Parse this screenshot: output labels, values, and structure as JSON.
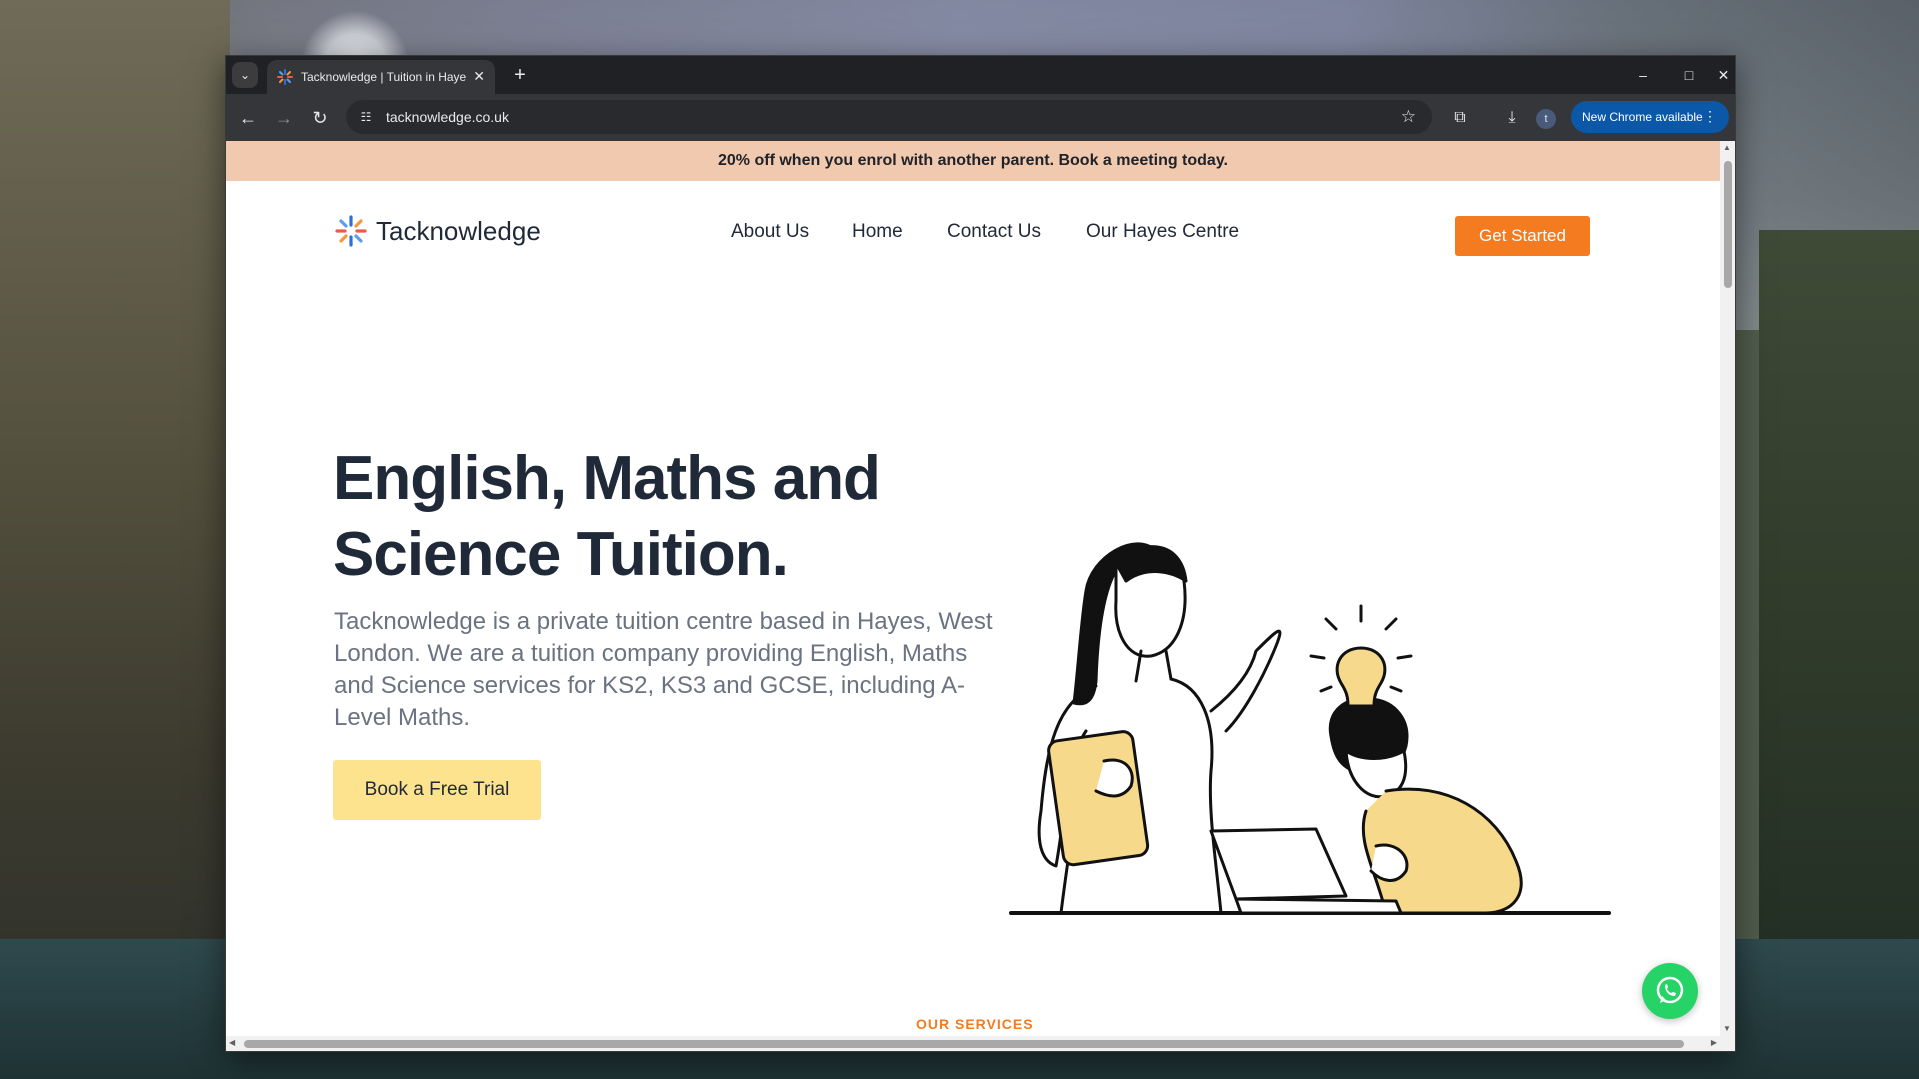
{
  "browser": {
    "tab_title": "Tacknowledge | Tuition in Hayes",
    "tab_close": "✕",
    "new_tab": "+",
    "url": "tacknowledge.co.uk",
    "update_label": "New Chrome available",
    "profile_initial": "t"
  },
  "site": {
    "promo": "20% off when you enrol with another parent. Book a meeting today.",
    "brand_name": "Tacknowledge",
    "nav": [
      "About Us",
      "Home",
      "Contact Us",
      "Our Hayes Centre"
    ],
    "cta": "Get Started",
    "hero_title_line1": "English, Maths and",
    "hero_title_line2": "Science Tuition.",
    "hero_text": "Tacknowledge is a private tuition centre based in Hayes, West London. We are a tuition company providing English, Maths and Science services for KS2, KS3 and GCSE, including A-Level Maths.",
    "trial_button": "Book a Free Trial",
    "services_label": "OUR SERVICES"
  },
  "colors": {
    "promo_bg": "#f1c9ae",
    "accent_orange": "#f47b20",
    "trial_yellow": "#fde38e",
    "heading": "#1f2937",
    "body_text": "#6b7280",
    "whatsapp_green": "#25d366",
    "chrome_dark": "#202124",
    "update_blue": "#0b57a8"
  }
}
